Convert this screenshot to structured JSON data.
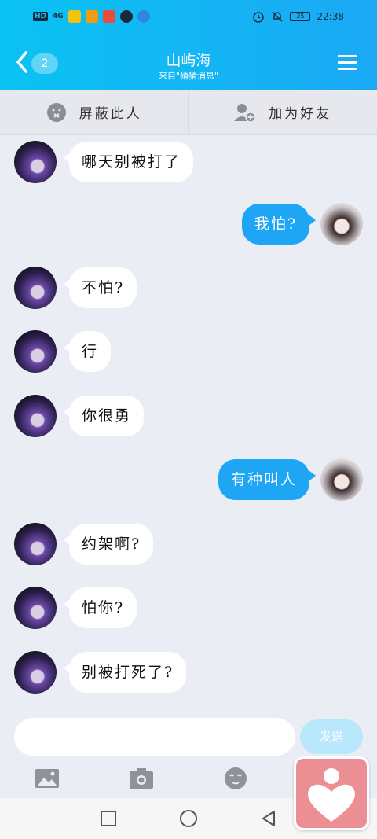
{
  "status_bar": {
    "hd": "HD",
    "signal": "4G",
    "battery": "25",
    "time": "22:38"
  },
  "header": {
    "back_badge": "2",
    "title": "山屿海",
    "subtitle": "来自\"猜猜消息\""
  },
  "actions": {
    "block": "屏蔽此人",
    "add_friend": "加为好友"
  },
  "messages": [
    {
      "side": "in",
      "text": "哪天别被打了"
    },
    {
      "side": "out",
      "text": "我怕?"
    },
    {
      "side": "in",
      "text": "不怕?"
    },
    {
      "side": "in",
      "text": "行"
    },
    {
      "side": "in",
      "text": "你很勇"
    },
    {
      "side": "out",
      "text": "有种叫人"
    },
    {
      "side": "in",
      "text": "约架啊?"
    },
    {
      "side": "in",
      "text": "怕你?"
    },
    {
      "side": "in",
      "text": "别被打死了?"
    }
  ],
  "composer": {
    "input_value": "",
    "placeholder": "",
    "send_label": "发送"
  },
  "toolbar_icons": [
    "image-icon",
    "camera-icon",
    "emoji-icon"
  ],
  "colors": {
    "header_start": "#0ac2f3",
    "header_end": "#1aa9f5",
    "outgoing_bubble": "#1ea6f5",
    "incoming_bubble": "#ffffff",
    "send_button": "#b9e7fb",
    "floating_widget": "#ec8f95"
  }
}
